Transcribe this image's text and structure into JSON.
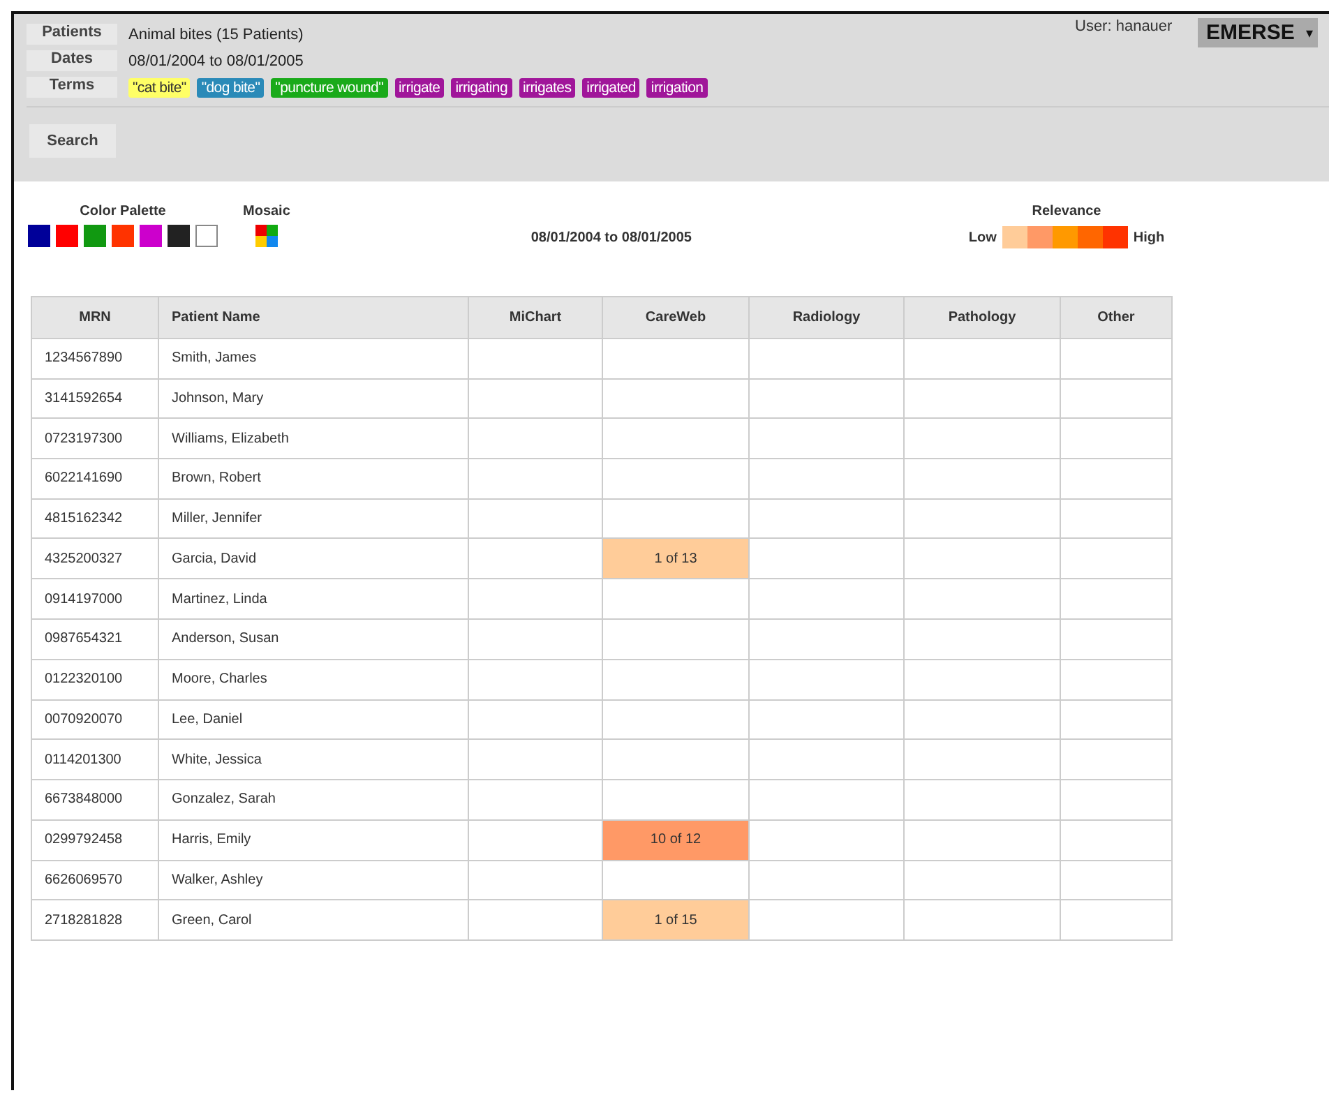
{
  "header": {
    "fields": [
      {
        "label": "Patients",
        "value": "Animal bites (15 Patients)"
      },
      {
        "label": "Dates",
        "value": "08/01/2004 to 08/01/2005"
      }
    ],
    "terms_label": "Terms",
    "terms": [
      {
        "text": "\"cat bite\"",
        "color": "#ffff66"
      },
      {
        "text": "\"dog bite\"",
        "color": "#2a8ab8"
      },
      {
        "text": "\"puncture wound\"",
        "color": "#1aaa1a"
      },
      {
        "text": "irrigate",
        "color": "#a0169a"
      },
      {
        "text": "irrigating",
        "color": "#a0169a"
      },
      {
        "text": "irrigates",
        "color": "#a0169a"
      },
      {
        "text": "irrigated",
        "color": "#a0169a"
      },
      {
        "text": "irrigation",
        "color": "#a0169a"
      }
    ],
    "user": "User: hanauer",
    "app_menu": "EMERSE",
    "app_menu_caret": "▾",
    "search_button": "Search"
  },
  "legend": {
    "palette_title": "Color Palette",
    "palette": [
      {
        "color": "#000099"
      },
      {
        "color": "#ff0000"
      },
      {
        "color": "#119911"
      },
      {
        "color": "#ff3300"
      },
      {
        "color": "#cc00cc"
      },
      {
        "color": "#222222"
      },
      {
        "color": "#ffffff"
      }
    ],
    "mosaic_title": "Mosaic",
    "date_range": "08/01/2004 to 08/01/2005",
    "relevance_title": "Relevance",
    "low": "Low",
    "high": "High",
    "scale": [
      {
        "color": "#ffcc99"
      },
      {
        "color": "#ff9966"
      },
      {
        "color": "#ff9900"
      },
      {
        "color": "#ff6600"
      },
      {
        "color": "#ff3300"
      }
    ]
  },
  "table": {
    "columns": [
      "MRN",
      "Patient Name",
      "MiChart",
      "CareWeb",
      "Radiology",
      "Pathology",
      "Other"
    ],
    "rows": [
      {
        "mrn": "1234567890",
        "name": "Smith, James"
      },
      {
        "mrn": "3141592654",
        "name": "Johnson, Mary"
      },
      {
        "mrn": "0723197300",
        "name": "Williams, Elizabeth"
      },
      {
        "mrn": "6022141690",
        "name": "Brown, Robert"
      },
      {
        "mrn": "4815162342",
        "name": "Miller, Jennifer"
      },
      {
        "mrn": "4325200327",
        "name": "Garcia, David",
        "careweb_hit": {
          "text": "1 of 13",
          "color": "#ffcc99"
        }
      },
      {
        "mrn": "0914197000",
        "name": "Martinez, Linda"
      },
      {
        "mrn": "0987654321",
        "name": "Anderson, Susan"
      },
      {
        "mrn": "0122320100",
        "name": "Moore, Charles"
      },
      {
        "mrn": "0070920070",
        "name": "Lee, Daniel"
      },
      {
        "mrn": "0114201300",
        "name": "White, Jessica"
      },
      {
        "mrn": "6673848000",
        "name": "Gonzalez, Sarah"
      },
      {
        "mrn": "0299792458",
        "name": "Harris, Emily",
        "careweb_hit": {
          "text": "10 of 12",
          "color": "#ff9966"
        }
      },
      {
        "mrn": "6626069570",
        "name": "Walker, Ashley"
      },
      {
        "mrn": "2718281828",
        "name": "Green, Carol",
        "careweb_hit": {
          "text": "1 of 15",
          "color": "#ffcc99"
        }
      }
    ]
  }
}
